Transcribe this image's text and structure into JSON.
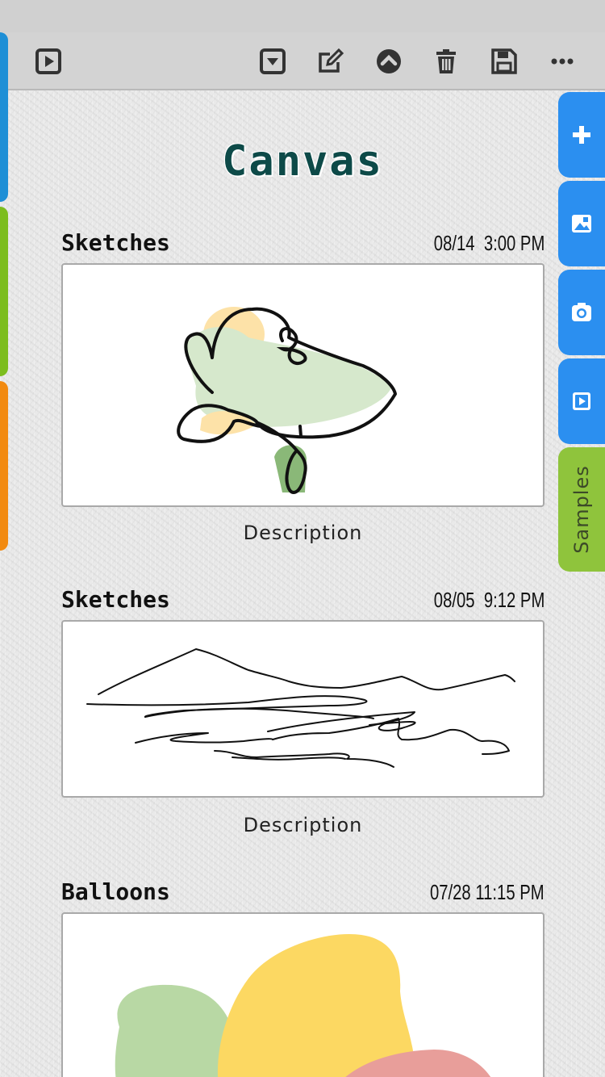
{
  "toolbar": {
    "icons": [
      "play-square-icon",
      "dropdown-square-icon",
      "edit-icon",
      "chevron-up-circle-icon",
      "trash-icon",
      "save-icon",
      "more-icon"
    ]
  },
  "side_tabs": {
    "icons": [
      "plus-icon",
      "image-icon",
      "camera-icon",
      "video-icon"
    ],
    "samples_label": "Samples"
  },
  "page": {
    "title": "Canvas"
  },
  "cards": [
    {
      "title": "Sketches",
      "timestamp": "08/14  3:00 PM",
      "description": "Description"
    },
    {
      "title": "Sketches",
      "timestamp": "08/05  9:12 PM",
      "description": "Description"
    },
    {
      "title": "Balloons",
      "timestamp": "07/28 11:15 PM"
    }
  ],
  "colors": {
    "left_tabs": [
      "#1e8fd6",
      "#7cbd1e",
      "#f28a10"
    ],
    "side_tab": "#2b8ff0",
    "samples_tab": "#8fc43c",
    "title": "#0d4a48"
  }
}
